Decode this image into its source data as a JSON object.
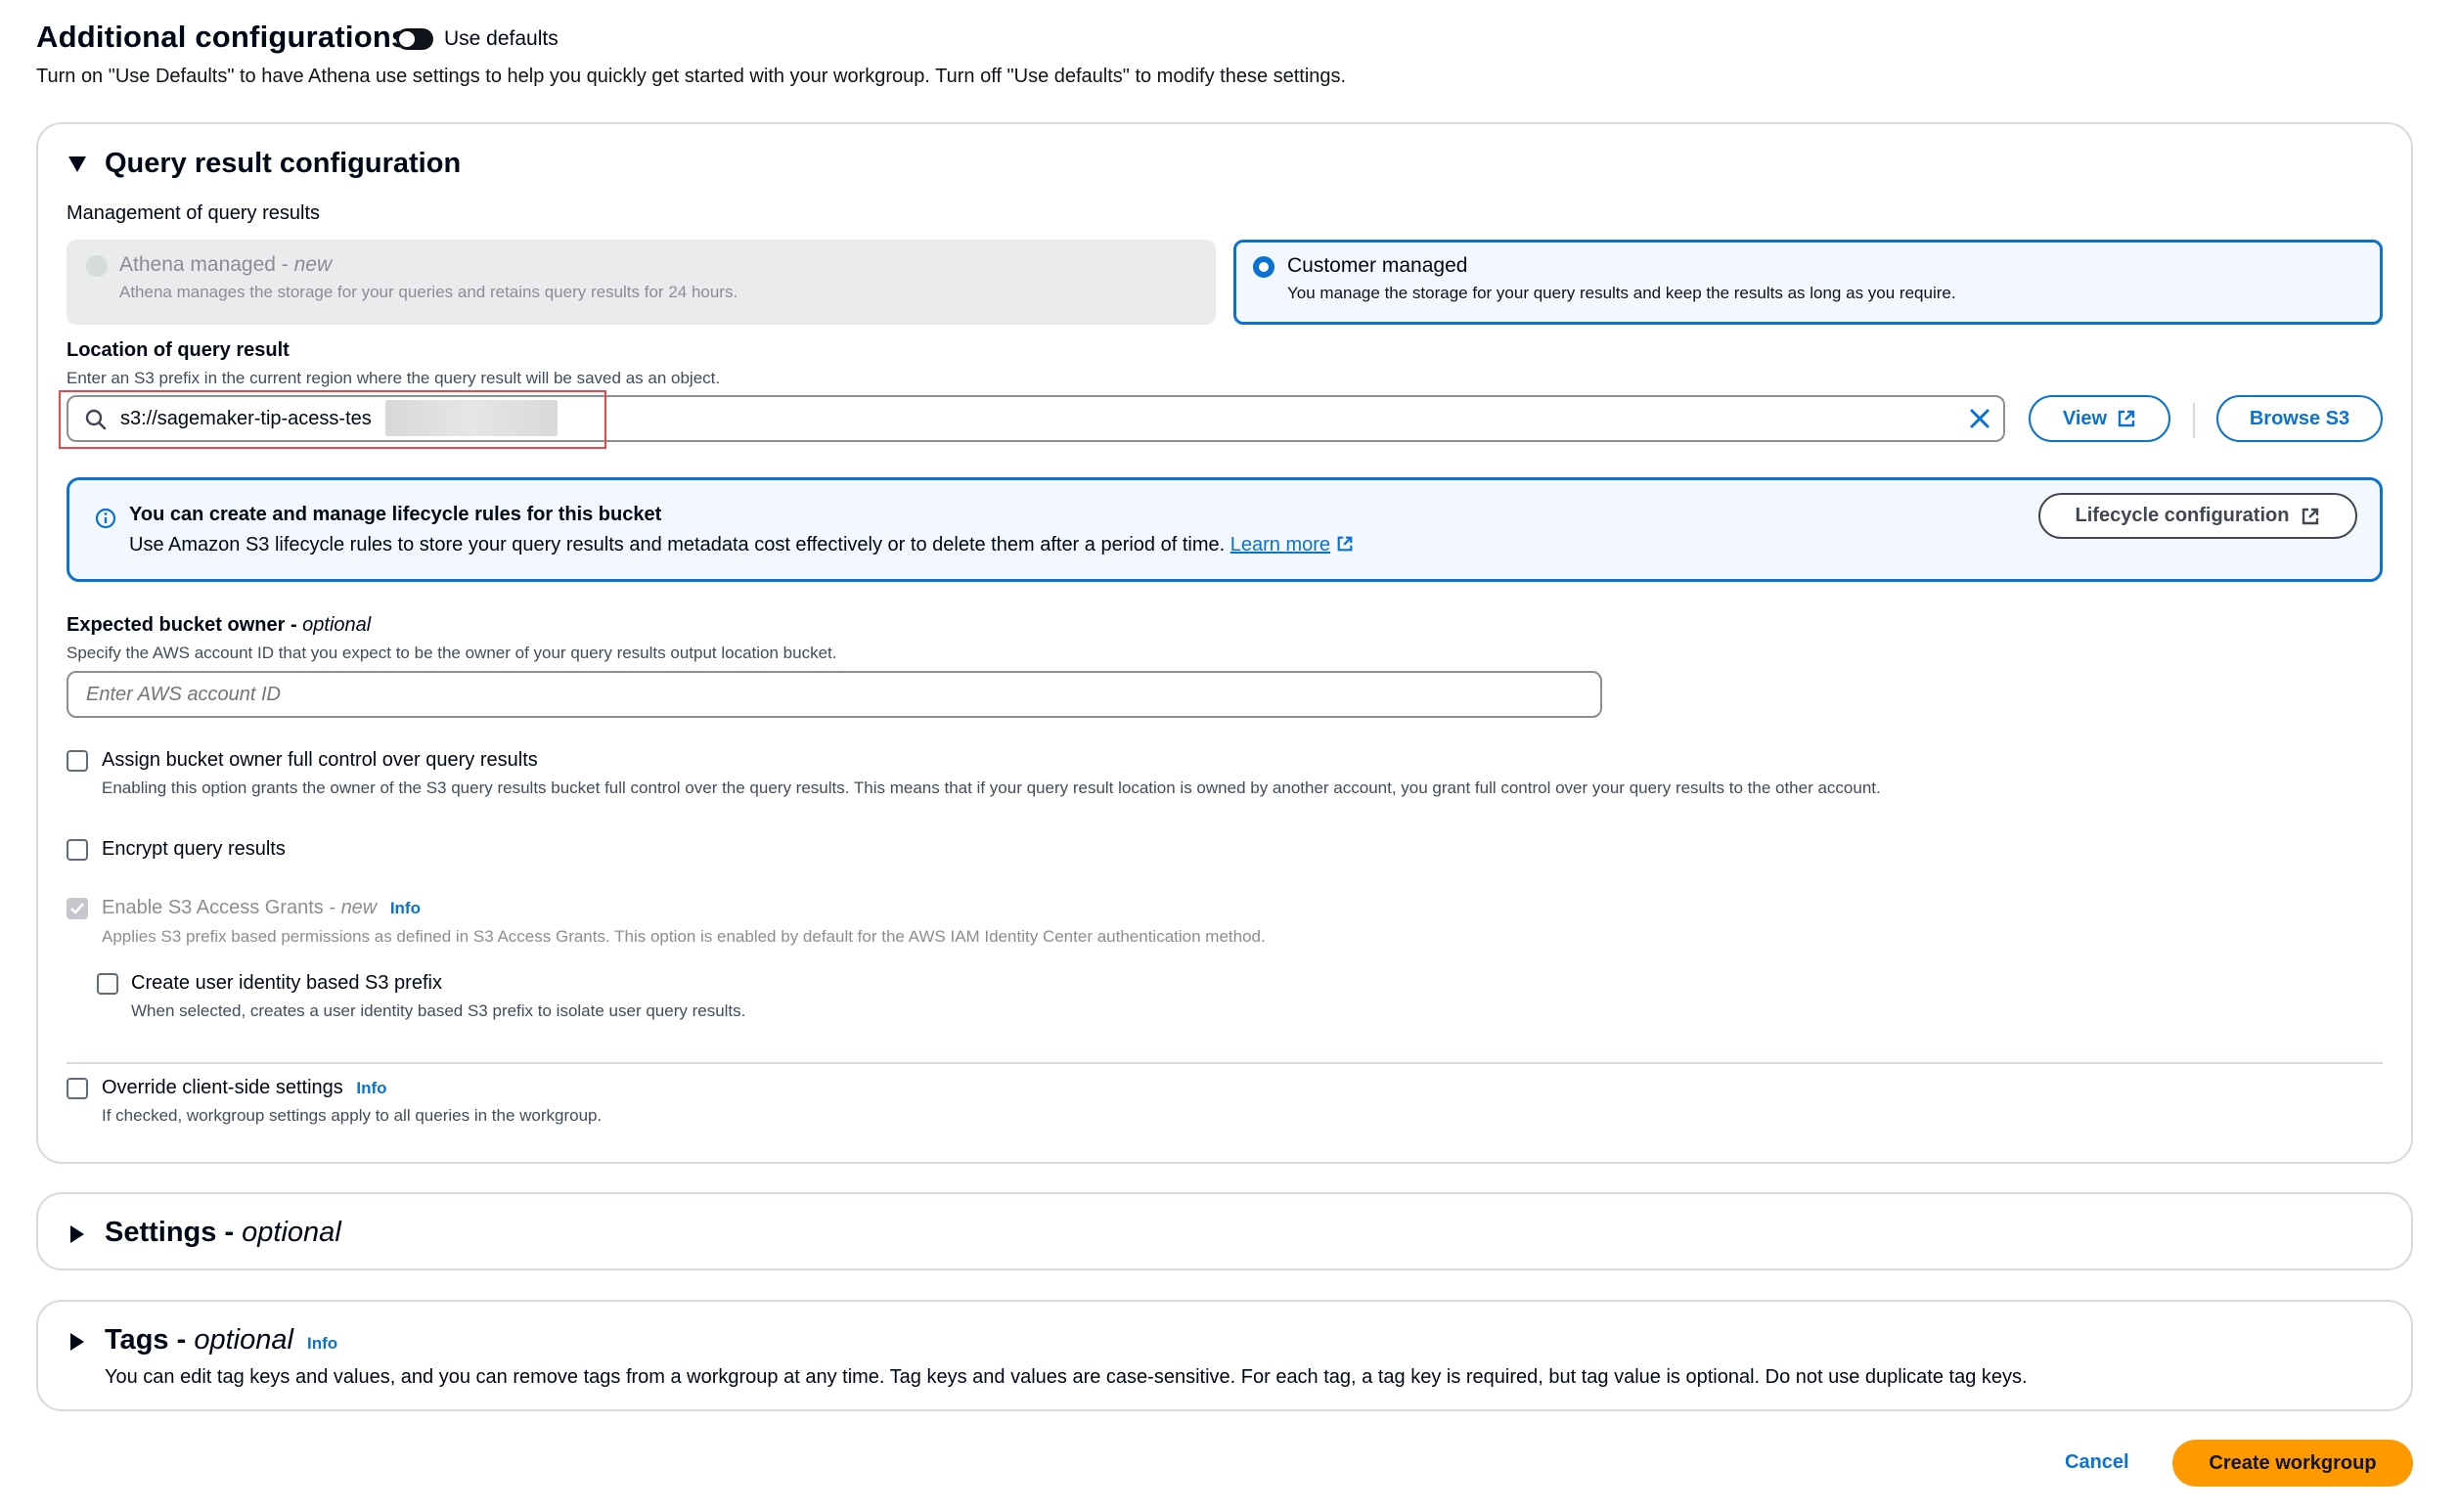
{
  "header": {
    "title": "Additional configurations",
    "toggle_label": "Use defaults",
    "description": "Turn on \"Use Defaults\" to have Athena use settings to help you quickly get started with your workgroup. Turn off \"Use defaults\" to modify these settings."
  },
  "query_result": {
    "title": "Query result configuration",
    "management_label": "Management of query results",
    "options": [
      {
        "label": "Athena managed - ",
        "tag": "new",
        "description": "Athena manages the storage for your queries and retains query results for 24 hours.",
        "selected": false,
        "disabled": true
      },
      {
        "label": "Customer managed",
        "tag": "",
        "description": "You manage the storage for your query results and keep the results as long as you require.",
        "selected": true,
        "disabled": false
      }
    ],
    "location": {
      "label": "Location of query result",
      "description": "Enter an S3 prefix in the current region where the query result will be saved as an object.",
      "value": "s3://sagemaker-tip-acess-tes",
      "view_button": "View",
      "browse_button": "Browse S3"
    },
    "alert": {
      "title": "You can create and manage lifecycle rules for this bucket",
      "body": "Use Amazon S3 lifecycle rules to store your query results and metadata cost effectively or to delete them after a period of time.",
      "link": "Learn more",
      "button": "Lifecycle configuration"
    },
    "bucket_owner": {
      "label": "Expected bucket owner - ",
      "optional": "optional",
      "description": "Specify the AWS account ID that you expect to be the owner of your query results output location bucket.",
      "placeholder": "Enter AWS account ID"
    },
    "checkboxes": {
      "full_control": {
        "label": "Assign bucket owner full control over query results",
        "description": "Enabling this option grants the owner of the S3 query results bucket full control over the query results. This means that if your query result location is owned by another account, you grant full control over your query results to the other account.",
        "checked": false
      },
      "encrypt": {
        "label": "Encrypt query results",
        "checked": false
      },
      "access_grants": {
        "label": "Enable S3 Access Grants - ",
        "tag": "new",
        "info": "Info",
        "description": "Applies S3 prefix based permissions as defined in S3 Access Grants. This option is enabled by default for the AWS IAM Identity Center authentication method.",
        "checked": true,
        "disabled": true
      },
      "identity_prefix": {
        "label": "Create user identity based S3 prefix",
        "description": "When selected, creates a user identity based S3 prefix to isolate user query results.",
        "checked": false
      },
      "override": {
        "label": "Override client-side settings",
        "info": "Info",
        "description": "If checked, workgroup settings apply to all queries in the workgroup.",
        "checked": false
      }
    }
  },
  "settings": {
    "title": "Settings - ",
    "optional": "optional"
  },
  "tags": {
    "title": "Tags - ",
    "optional": "optional",
    "info": "Info",
    "description": "You can edit tag keys and values, and you can remove tags from a workgroup at any time. Tag keys and values are case-sensitive. For each tag, a tag key is required, but tag value is optional. Do not use duplicate tag keys."
  },
  "footer": {
    "cancel": "Cancel",
    "create": "Create workgroup"
  },
  "colors": {
    "accent": "#0972d3",
    "primary_button": "#ff9900",
    "highlight_box": "#e44a4a"
  }
}
